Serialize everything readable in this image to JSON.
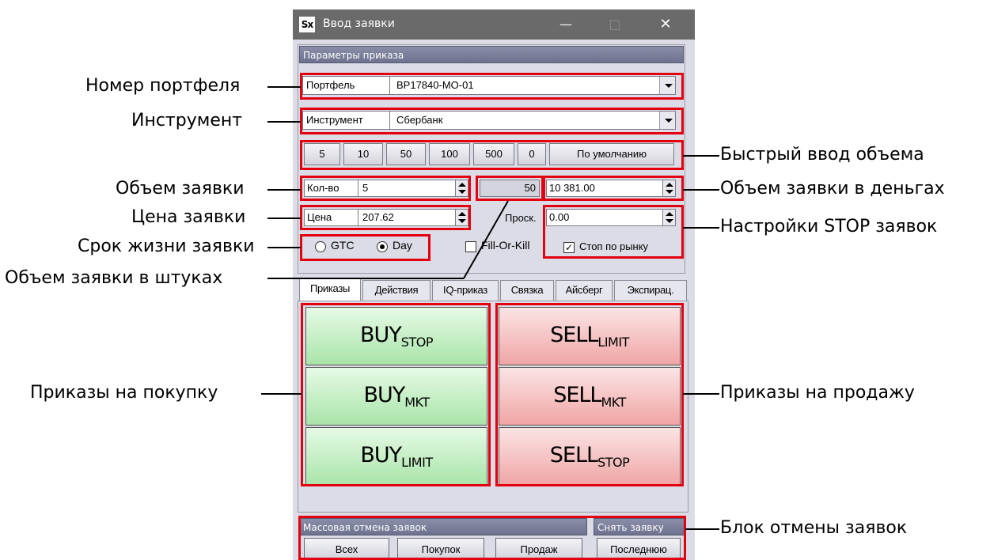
{
  "window": {
    "title": "Ввод заявки",
    "icon_text": "Sx",
    "minimize": "—",
    "maximize": "□",
    "close": "✕"
  },
  "params_header": "Параметры приказа",
  "portfolio": {
    "label": "Портфель",
    "value": "BP17840-MO-01"
  },
  "instrument": {
    "label": "Инструмент",
    "value": "Сбербанк"
  },
  "quick_volume": [
    "5",
    "10",
    "50",
    "100",
    "500",
    "0",
    "По умолчанию"
  ],
  "qty": {
    "label": "Кол-во",
    "value": "5"
  },
  "shares_value": "50",
  "money_value": "10 381.00",
  "price": {
    "label": "Цена",
    "value": "207.62"
  },
  "slippage": {
    "label": "Проск.",
    "value": "0.00"
  },
  "lifetime": {
    "gtc": "GTC",
    "day": "Day"
  },
  "fill_or_kill": "Fill-Or-Kill",
  "stop_market": "Стоп по рынку",
  "tabs": [
    "Приказы",
    "Действия",
    "IQ-приказ",
    "Связка",
    "Айсберг",
    "Экспирац."
  ],
  "buy_buttons": [
    {
      "main": "BUY",
      "sub": "STOP"
    },
    {
      "main": "BUY",
      "sub": "MKT"
    },
    {
      "main": "BUY",
      "sub": "LIMIT"
    }
  ],
  "sell_buttons": [
    {
      "main": "SELL",
      "sub": "LIMIT"
    },
    {
      "main": "SELL",
      "sub": "MKT"
    },
    {
      "main": "SELL",
      "sub": "STOP"
    }
  ],
  "mass_cancel": {
    "header": "Массовая отмена заявок",
    "all": "Всех",
    "buys": "Покупок",
    "sells": "Продаж"
  },
  "cancel_order": {
    "header": "Снять заявку",
    "last": "Последнюю"
  },
  "callouts": {
    "portfolio_number": "Номер портфеля",
    "instrument": "Инструмент",
    "order_volume": "Объем заявки",
    "order_price": "Цена заявки",
    "order_lifetime": "Срок жизни заявки",
    "volume_in_shares": "Объем заявки в штуках",
    "buy_orders": "Приказы на покупку",
    "quick_volume": "Быстрый ввод объема",
    "volume_in_money": "Объем заявки в деньгах",
    "stop_settings": "Настройки STOP заявок",
    "sell_orders": "Приказы на продажу",
    "cancel_block": "Блок отмены заявок"
  }
}
